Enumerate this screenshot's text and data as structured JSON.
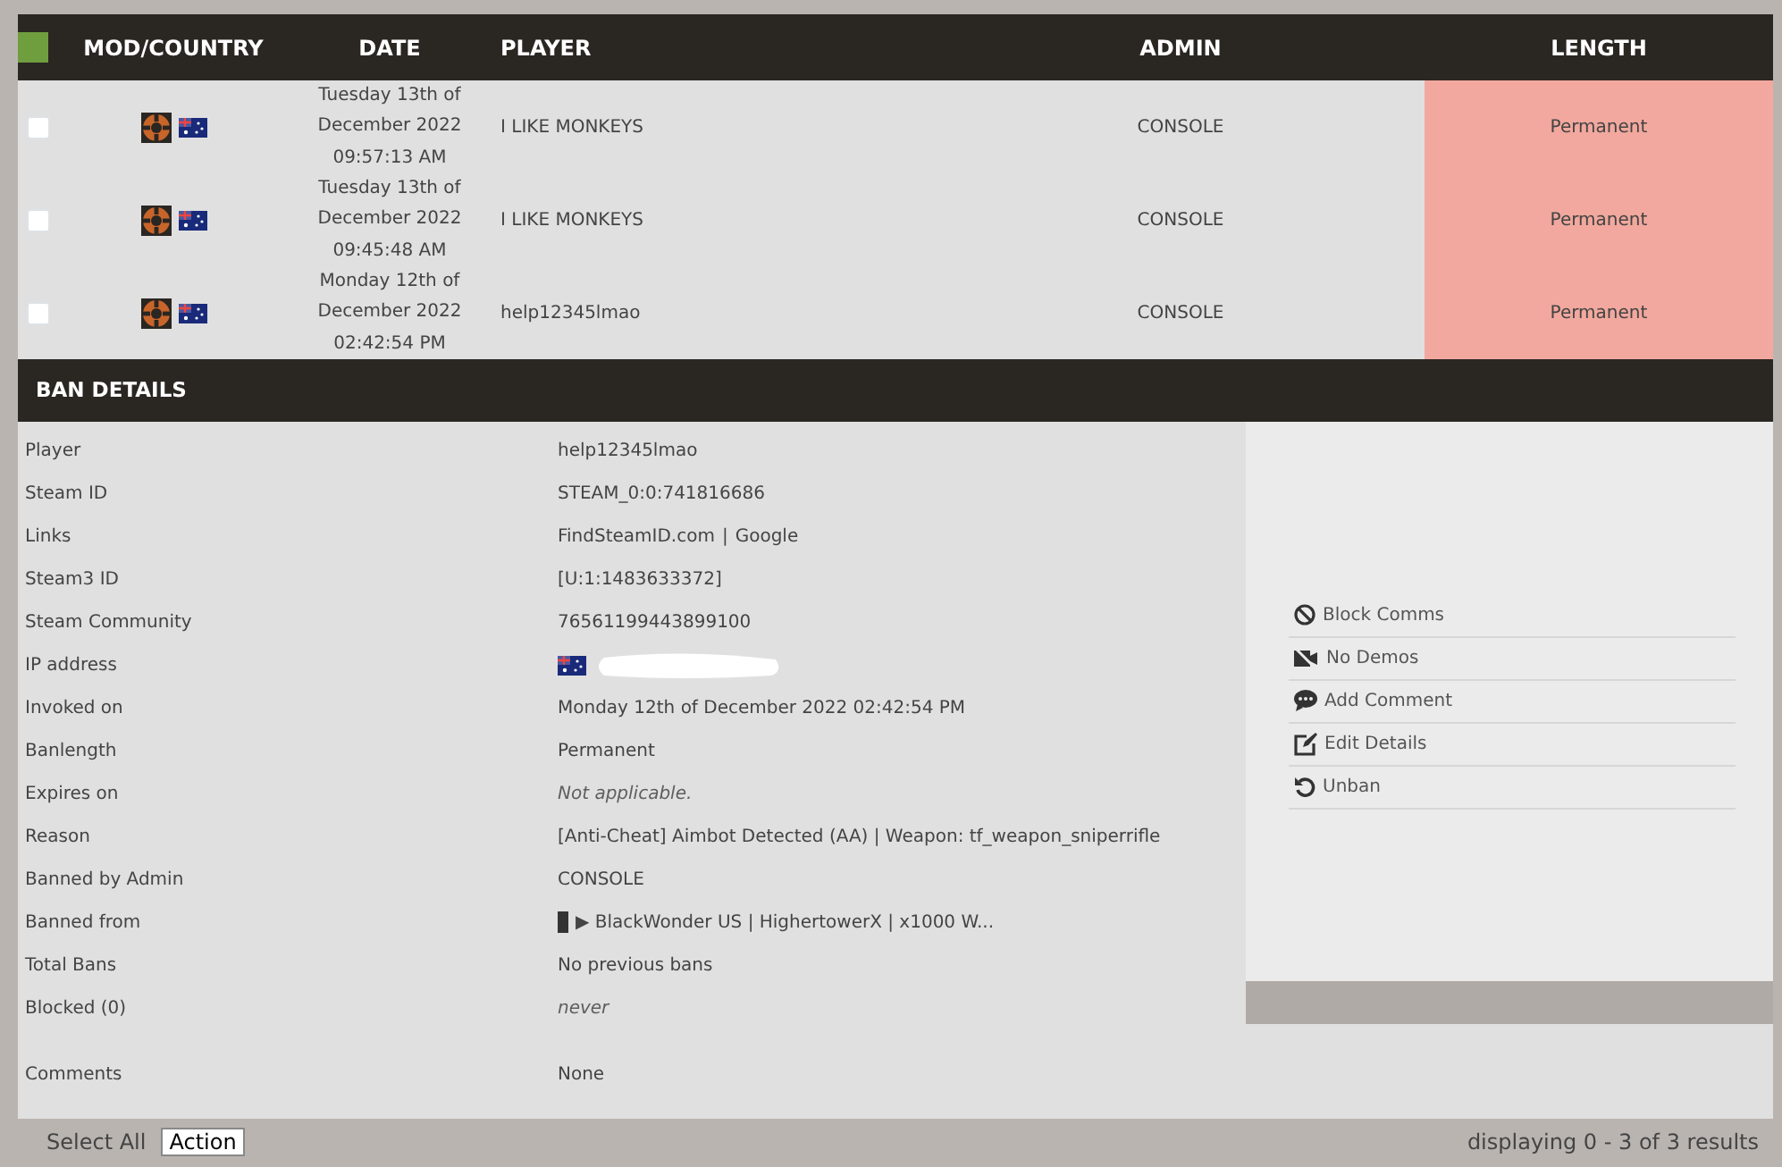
{
  "table": {
    "columns": [
      "MOD/COUNTRY",
      "DATE",
      "PLAYER",
      "ADMIN",
      "LENGTH"
    ],
    "rows": [
      {
        "checked": false,
        "date": [
          "Tuesday 13th of",
          "December 2022",
          "09:57:13 AM"
        ],
        "player": "I LIKE MONKEYS",
        "admin": "CONSOLE",
        "length": "Permanent",
        "color": "#f2a89e"
      },
      {
        "checked": false,
        "date": [
          "Tuesday 13th of",
          "December 2022",
          "09:45:48 AM"
        ],
        "player": "I LIKE MONKEYS",
        "admin": "CONSOLE",
        "length": "Permanent",
        "color": "#f2a89e"
      },
      {
        "checked": false,
        "date": [
          "Monday 12th of",
          "December 2022",
          "02:42:54 PM"
        ],
        "player": "help12345lmao",
        "admin": "CONSOLE",
        "length": "Permanent",
        "color": "#f2a89e"
      }
    ]
  },
  "ban_details": {
    "title": "BAN DETAILS",
    "fields": [
      {
        "label": "Player",
        "value": "help12345lmao",
        "kind": "text"
      },
      {
        "label": "Steam ID",
        "value": "STEAM_0:0:741816686",
        "kind": "text"
      },
      {
        "label": "Links",
        "links": [
          "FindSteamID.com",
          "Google"
        ],
        "separator": "|",
        "kind": "links"
      },
      {
        "label": "Steam3 ID",
        "value": "[U:1:1483633372]",
        "kind": "text"
      },
      {
        "label": "Steam Community",
        "value": "76561199443899100",
        "kind": "text"
      },
      {
        "label": "IP address",
        "kind": "ip"
      },
      {
        "label": "Invoked on",
        "value": "Monday 12th of December 2022 02:42:54 PM",
        "kind": "text"
      },
      {
        "label": "Banlength",
        "value": "Permanent",
        "kind": "text"
      },
      {
        "label": "Expires on",
        "value": "Not applicable.",
        "kind": "muted"
      },
      {
        "label": "Reason",
        "value": "[Anti-Cheat] Aimbot Detected (AA) | Weapon: tf_weapon_sniperrifle",
        "kind": "text"
      },
      {
        "label": "Banned by Admin",
        "value": "CONSOLE",
        "kind": "text"
      },
      {
        "label": "Banned from",
        "value": "▶ BlackWonder US | HighertowerX | x1000 W...",
        "kind": "server"
      },
      {
        "label": "Total Bans",
        "value": "No previous bans",
        "kind": "text"
      },
      {
        "label": "Blocked (0)",
        "value": "never",
        "kind": "muted"
      }
    ],
    "comments": {
      "label": "Comments",
      "value": "None"
    },
    "actions": [
      {
        "label": "Block Comms",
        "kind": "block"
      },
      {
        "label": "No Demos",
        "kind": "nodemo"
      },
      {
        "label": "Add Comment",
        "kind": "comment"
      },
      {
        "label": "Edit Details",
        "kind": "edit"
      },
      {
        "label": "Unban",
        "kind": "unban"
      }
    ]
  },
  "footer": {
    "select_all": "Select All",
    "action": "Action",
    "results": "displaying 0 - 3 of 3 results"
  }
}
